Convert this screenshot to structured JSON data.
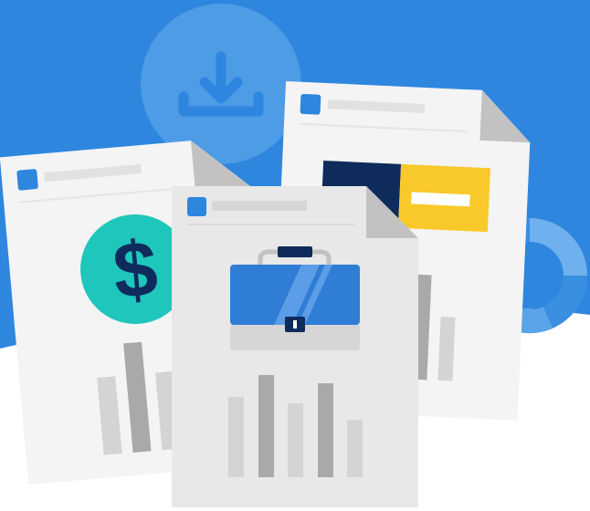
{
  "illustration": {
    "colors": {
      "background_blue": "#2E86DE",
      "ground_white": "#FFFFFF",
      "download_circle": "#4E9BE6",
      "paper_light": "#F4F4F4",
      "paper_front": "#E8E8E8",
      "fold": "#C2C2C2",
      "accent_blue": "#2E86DE",
      "navy": "#0E2B5C",
      "yellow": "#F9C82B",
      "teal": "#1EC6BC",
      "bar_dark": "#A9A9A9",
      "bar_light": "#D4D4D4",
      "briefcase_blue": "#2F7DD5"
    },
    "icons": [
      "download-icon",
      "dollar-sign-icon",
      "briefcase-icon",
      "donut-chart-icon"
    ],
    "documents": [
      {
        "name": "finance-document",
        "icon": "dollar-sign-icon"
      },
      {
        "name": "report-document",
        "icon": "donut-chart-icon"
      },
      {
        "name": "business-document",
        "icon": "briefcase-icon"
      }
    ],
    "dollar_symbol": "$"
  }
}
